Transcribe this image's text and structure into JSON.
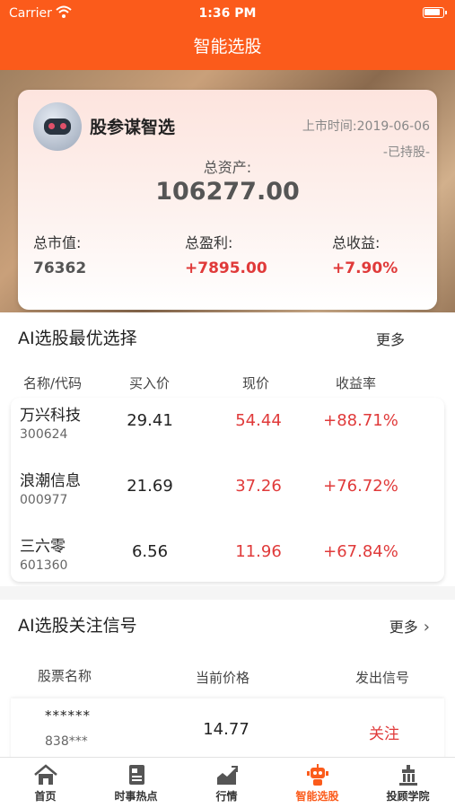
{
  "status_bar": {
    "carrier": "Carrier",
    "time": "1:36 PM"
  },
  "nav": {
    "title": "智能选股"
  },
  "summary": {
    "name": "股参谋智选",
    "listing_date": "上市时间:2019-06-06",
    "holding_status": "-已持股-",
    "total_assets_label": "总资产:",
    "total_assets_value": "106277.00",
    "market_value_label": "总市值:",
    "market_value": "76362",
    "profit_label": "总盈利:",
    "profit_value": "+7895.00",
    "return_label": "总收益:",
    "return_value": "+7.90%"
  },
  "best_picks": {
    "title": "AI选股最优选择",
    "more": "更多",
    "headers": [
      "名称/代码",
      "买入价",
      "现价",
      "收益率"
    ],
    "rows": [
      {
        "name": "万兴科技",
        "code": "300624",
        "buy": "29.41",
        "price": "54.44",
        "yield": "+88.71%"
      },
      {
        "name": "浪潮信息",
        "code": "000977",
        "buy": "21.69",
        "price": "37.26",
        "yield": "+76.72%"
      },
      {
        "name": "三六零",
        "code": "601360",
        "buy": "6.56",
        "price": "11.96",
        "yield": "+67.84%"
      }
    ]
  },
  "signals": {
    "title": "AI选股关注信号",
    "more": "更多",
    "headers": [
      "股票名称",
      "当前价格",
      "发出信号"
    ],
    "rows": [
      {
        "name": "******",
        "code": "838***",
        "price": "14.77",
        "signal": "关注"
      }
    ]
  },
  "tabbar": {
    "items": [
      {
        "label": "首页",
        "icon": "home-icon"
      },
      {
        "label": "时事热点",
        "icon": "news-icon"
      },
      {
        "label": "行情",
        "icon": "market-chart-icon"
      },
      {
        "label": "智能选股",
        "icon": "robot-icon",
        "active": true
      },
      {
        "label": "投顾学院",
        "icon": "academy-icon"
      }
    ]
  },
  "colors": {
    "brand": "#fb5b1b",
    "gain": "#e03a3a"
  }
}
